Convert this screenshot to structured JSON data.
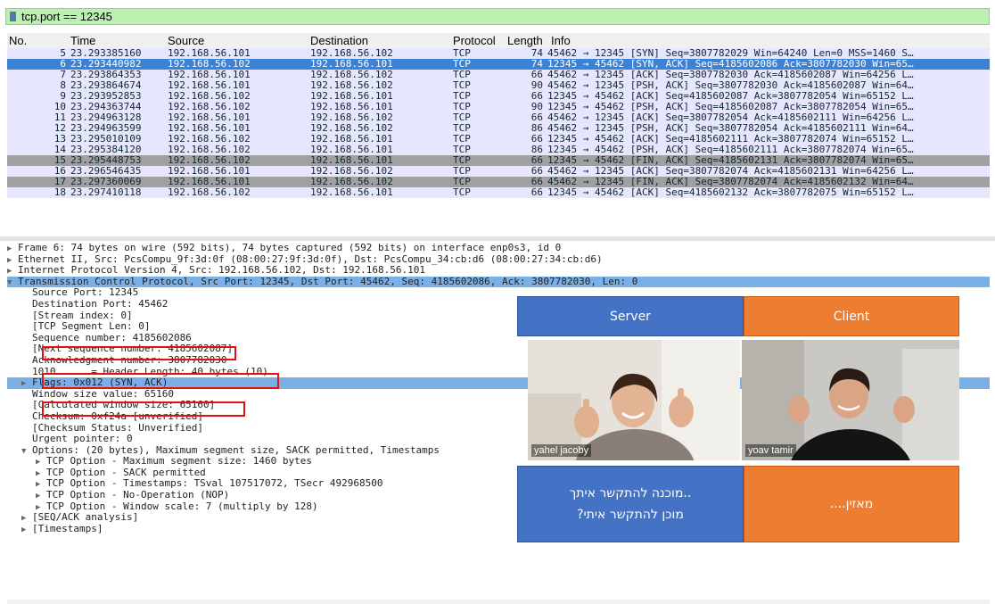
{
  "filter": {
    "value": "tcp.port == 12345"
  },
  "columns": [
    "No.",
    "Time",
    "Source",
    "Destination",
    "Protocol",
    "Length",
    "Info"
  ],
  "packets": [
    {
      "no": "5",
      "time": "23.293385160",
      "src": "192.168.56.101",
      "dst": "192.168.56.102",
      "proto": "TCP",
      "len": "74",
      "info": "45462 → 12345 [SYN] Seq=3807782029 Win=64240 Len=0 MSS=1460 S…",
      "style": "tcp"
    },
    {
      "no": "6",
      "time": "23.293440982",
      "src": "192.168.56.102",
      "dst": "192.168.56.101",
      "proto": "TCP",
      "len": "74",
      "info": "12345 → 45462 [SYN, ACK] Seq=4185602086 Ack=3807782030 Win=65…",
      "style": "sel"
    },
    {
      "no": "7",
      "time": "23.293864353",
      "src": "192.168.56.101",
      "dst": "192.168.56.102",
      "proto": "TCP",
      "len": "66",
      "info": "45462 → 12345 [ACK] Seq=3807782030 Ack=4185602087 Win=64256 L…",
      "style": "tcp"
    },
    {
      "no": "8",
      "time": "23.293864674",
      "src": "192.168.56.101",
      "dst": "192.168.56.102",
      "proto": "TCP",
      "len": "90",
      "info": "45462 → 12345 [PSH, ACK] Seq=3807782030 Ack=4185602087 Win=64…",
      "style": "tcp"
    },
    {
      "no": "9",
      "time": "23.293952853",
      "src": "192.168.56.102",
      "dst": "192.168.56.101",
      "proto": "TCP",
      "len": "66",
      "info": "12345 → 45462 [ACK] Seq=4185602087 Ack=3807782054 Win=65152 L…",
      "style": "tcp"
    },
    {
      "no": "10",
      "time": "23.294363744",
      "src": "192.168.56.102",
      "dst": "192.168.56.101",
      "proto": "TCP",
      "len": "90",
      "info": "12345 → 45462 [PSH, ACK] Seq=4185602087 Ack=3807782054 Win=65…",
      "style": "tcp"
    },
    {
      "no": "11",
      "time": "23.294963128",
      "src": "192.168.56.101",
      "dst": "192.168.56.102",
      "proto": "TCP",
      "len": "66",
      "info": "45462 → 12345 [ACK] Seq=3807782054 Ack=4185602111 Win=64256 L…",
      "style": "tcp"
    },
    {
      "no": "12",
      "time": "23.294963599",
      "src": "192.168.56.101",
      "dst": "192.168.56.102",
      "proto": "TCP",
      "len": "86",
      "info": "45462 → 12345 [PSH, ACK] Seq=3807782054 Ack=4185602111 Win=64…",
      "style": "tcp"
    },
    {
      "no": "13",
      "time": "23.295010109",
      "src": "192.168.56.102",
      "dst": "192.168.56.101",
      "proto": "TCP",
      "len": "66",
      "info": "12345 → 45462 [ACK] Seq=4185602111 Ack=3807782074 Win=65152 L…",
      "style": "tcp"
    },
    {
      "no": "14",
      "time": "23.295384120",
      "src": "192.168.56.102",
      "dst": "192.168.56.101",
      "proto": "TCP",
      "len": "86",
      "info": "12345 → 45462 [PSH, ACK] Seq=4185602111 Ack=3807782074 Win=65…",
      "style": "tcp"
    },
    {
      "no": "15",
      "time": "23.295448753",
      "src": "192.168.56.102",
      "dst": "192.168.56.101",
      "proto": "TCP",
      "len": "66",
      "info": "12345 → 45462 [FIN, ACK] Seq=4185602131 Ack=3807782074 Win=65…",
      "style": "fin"
    },
    {
      "no": "16",
      "time": "23.296546435",
      "src": "192.168.56.101",
      "dst": "192.168.56.102",
      "proto": "TCP",
      "len": "66",
      "info": "45462 → 12345 [ACK] Seq=3807782074 Ack=4185602131 Win=64256 L…",
      "style": "tcp"
    },
    {
      "no": "17",
      "time": "23.297360069",
      "src": "192.168.56.101",
      "dst": "192.168.56.102",
      "proto": "TCP",
      "len": "66",
      "info": "45462 → 12345 [FIN, ACK] Seq=3807782074 Ack=4185602132 Win=64…",
      "style": "fin"
    },
    {
      "no": "18",
      "time": "23.297410118",
      "src": "192.168.56.102",
      "dst": "192.168.56.101",
      "proto": "TCP",
      "len": "66",
      "info": "12345 → 45462 [ACK] Seq=4185602132 Ack=3807782075 Win=65152 L…",
      "style": "tcp"
    }
  ],
  "details": [
    {
      "indent": 0,
      "tri": "right",
      "text": "Frame 6: 74 bytes on wire (592 bits), 74 bytes captured (592 bits) on interface enp0s3, id 0"
    },
    {
      "indent": 0,
      "tri": "right",
      "text": "Ethernet II, Src: PcsCompu_9f:3d:0f (08:00:27:9f:3d:0f), Dst: PcsCompu_34:cb:d6 (08:00:27:34:cb:d6)"
    },
    {
      "indent": 0,
      "tri": "right",
      "text": "Internet Protocol Version 4, Src: 192.168.56.102, Dst: 192.168.56.101"
    },
    {
      "indent": 0,
      "tri": "down",
      "text": "Transmission Control Protocol, Src Port: 12345, Dst Port: 45462, Seq: 4185602086, Ack: 3807782030, Len: 0",
      "hl": "hl"
    },
    {
      "indent": 1,
      "tri": "",
      "text": "Source Port: 12345"
    },
    {
      "indent": 1,
      "tri": "",
      "text": "Destination Port: 45462"
    },
    {
      "indent": 1,
      "tri": "",
      "text": "[Stream index: 0]"
    },
    {
      "indent": 1,
      "tri": "",
      "text": "[TCP Segment Len: 0]"
    },
    {
      "indent": 1,
      "tri": "",
      "text": "Sequence number: 4185602086"
    },
    {
      "indent": 1,
      "tri": "",
      "text": "[Next sequence number: 4185602087]"
    },
    {
      "indent": 1,
      "tri": "",
      "text": "Acknowledgment number: 3807782030"
    },
    {
      "indent": 1,
      "tri": "",
      "text": "1010 .... = Header Length: 40 bytes (10)"
    },
    {
      "indent": 1,
      "tri": "right",
      "text": "Flags: 0x012 (SYN, ACK)",
      "hl": "hl"
    },
    {
      "indent": 1,
      "tri": "",
      "text": "Window size value: 65160"
    },
    {
      "indent": 1,
      "tri": "",
      "text": "[Calculated window size: 65160]"
    },
    {
      "indent": 1,
      "tri": "",
      "text": "Checksum: 0xf24a [unverified]"
    },
    {
      "indent": 1,
      "tri": "",
      "text": "[Checksum Status: Unverified]"
    },
    {
      "indent": 1,
      "tri": "",
      "text": "Urgent pointer: 0"
    },
    {
      "indent": 1,
      "tri": "down",
      "text": "Options: (20 bytes), Maximum segment size, SACK permitted, Timestamps"
    },
    {
      "indent": 2,
      "tri": "right",
      "text": "TCP Option - Maximum segment size: 1460 bytes"
    },
    {
      "indent": 2,
      "tri": "right",
      "text": "TCP Option - SACK permitted"
    },
    {
      "indent": 2,
      "tri": "right",
      "text": "TCP Option - Timestamps: TSval 107517072, TSecr 492968500"
    },
    {
      "indent": 2,
      "tri": "right",
      "text": "TCP Option - No-Operation (NOP)"
    },
    {
      "indent": 2,
      "tri": "right",
      "text": "TCP Option - Window scale: 7 (multiply by 128)"
    },
    {
      "indent": 1,
      "tri": "right",
      "text": "[SEQ/ACK analysis]"
    },
    {
      "indent": 1,
      "tri": "right",
      "text": "[Timestamps]"
    }
  ],
  "overlay": {
    "server_label": "Server",
    "client_label": "Client",
    "server_name": "yahel jacoby",
    "client_name": "yoav tamir",
    "server_msg_line1": "..מוכנה להתקשר איתך",
    "server_msg_line2": "מוכן להתקשר איתי?",
    "client_msg": "מאזין....",
    "colors": {
      "blue": "#4472c4",
      "orange": "#ed7d31"
    }
  }
}
